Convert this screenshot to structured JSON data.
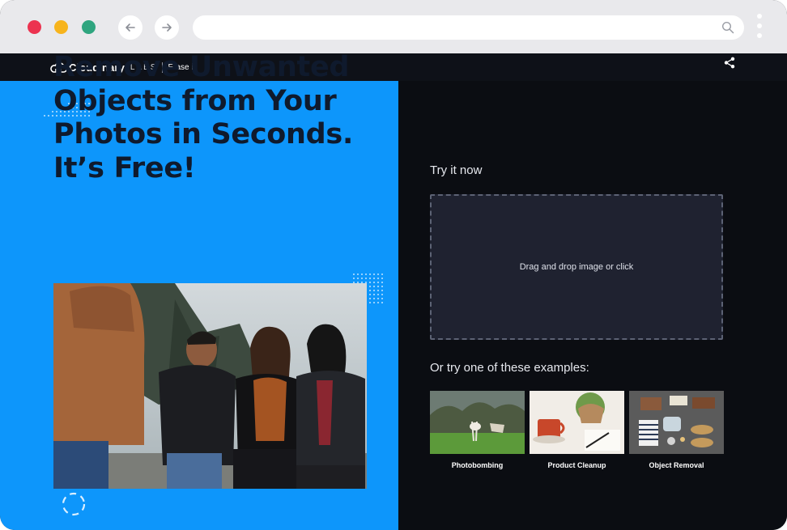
{
  "browser": {
    "traffic_lights": [
      "#ec3350",
      "#f7b41d",
      "#2fa57f"
    ],
    "url": ""
  },
  "header": {
    "logo_word": "Cloudinary",
    "logo_labs": "LABS",
    "product_name": "Erase it!",
    "share_icon": "share-icon"
  },
  "hero": {
    "headline": "Remove Unwanted Objects from Your Photos in Seconds. It’s Free!",
    "background": "#0d96fb"
  },
  "panel": {
    "try_label": "Try it now",
    "dropzone_text": "Drag and drop image or click",
    "examples_label": "Or try one of these examples:",
    "examples": [
      {
        "caption": "Photobombing"
      },
      {
        "caption": "Product Cleanup"
      },
      {
        "caption": "Object Removal"
      }
    ]
  }
}
